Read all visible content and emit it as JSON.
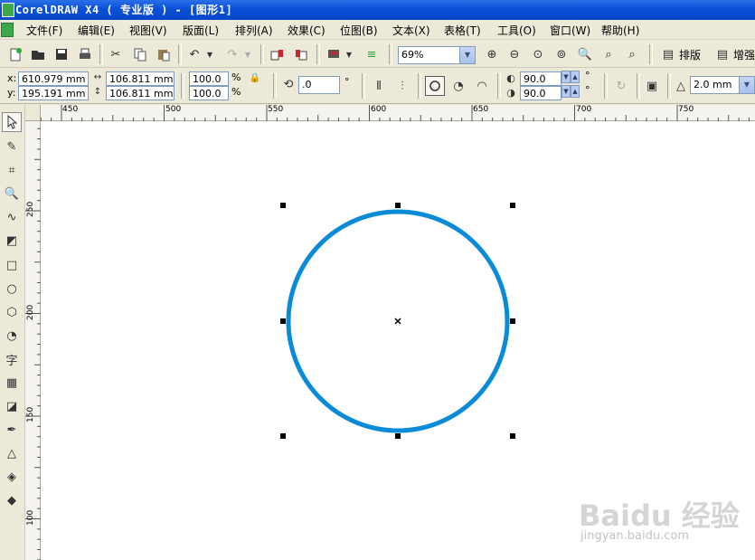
{
  "window": {
    "title": "CorelDRAW X4 ( 专业版 ) - [图形1]"
  },
  "menu": [
    "文件(F)",
    "编辑(E)",
    "视图(V)",
    "版面(L)",
    "排列(A)",
    "效果(C)",
    "位图(B)",
    "文本(X)",
    "表格(T)",
    "工具(O)",
    "窗口(W)",
    "帮助(H)"
  ],
  "toolbar": {
    "zoom_value": "69%",
    "arrange_label": "排版",
    "enhance_label": "增强"
  },
  "property_bar": {
    "x_label": "x:",
    "y_label": "y:",
    "x_value": "610.979 mm",
    "y_value": "195.191 mm",
    "width_value": "106.811 mm",
    "height_value": "106.811 mm",
    "scale_x": "100.0",
    "scale_y": "100.0",
    "percent_symbol": "%",
    "rotation_value": ".0",
    "degree_symbol": "°",
    "start_angle": "90.0",
    "end_angle": "90.0",
    "outline_width": "2.0 mm"
  },
  "ruler": {
    "h_labels": [
      "450",
      "500",
      "550",
      "600",
      "650",
      "700",
      "750"
    ],
    "v_labels": [
      "250",
      "200",
      "150",
      "100"
    ]
  },
  "shape": {
    "type": "ellipse",
    "outline_color": "#0a8bd8"
  },
  "watermark": {
    "brand": "Baidu 经验",
    "url": "jingyan.baidu.com"
  },
  "colors": {
    "titlebar": "#0a50d8",
    "chrome": "#ece9d8",
    "canvas": "#ffffff"
  }
}
